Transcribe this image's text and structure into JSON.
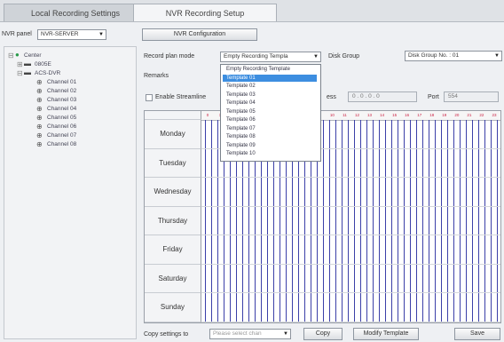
{
  "tabs": [
    {
      "label": "Local Recording Settings"
    },
    {
      "label": "NVR Recording Setup"
    }
  ],
  "topbar": {
    "nvr_label": "NVR panel",
    "nvr_value": "NVR-SERVER",
    "config_button": "NVR Configuration"
  },
  "tree": {
    "root": "Center",
    "nodes": [
      {
        "label": "0805E"
      },
      {
        "label": "ACS-DVR"
      }
    ],
    "channels": [
      "Channel 01",
      "Channel 02",
      "Channel 03",
      "Channel 04",
      "Channel 05",
      "Channel 06",
      "Channel 07",
      "Channel 08"
    ]
  },
  "form": {
    "mode_label": "Record plan mode",
    "mode_value": "Empty Recording Templa",
    "disk_group_label": "Disk Group",
    "disk_group_value": "Disk Group No. : 01",
    "remarks_label": "Remarks",
    "enable_label": "Enable Streamline",
    "ip_label": "ess",
    "ip_value": "0 . 0 . 0 . 0",
    "port_label": "Port",
    "port_value": "554"
  },
  "template_options": [
    "Empty Recording Template",
    "Template 01",
    "Template 02",
    "Template 03",
    "Template 04",
    "Template 05",
    "Template 06",
    "Template 07",
    "Template 08",
    "Template 09",
    "Template 10"
  ],
  "selected_option_index": 1,
  "schedule": {
    "days": [
      "Monday",
      "Tuesday",
      "Wednesday",
      "Thursday",
      "Friday",
      "Saturday",
      "Sunday"
    ],
    "hours": [
      "0",
      "1",
      "2",
      "3",
      "4",
      "5",
      "6",
      "7",
      "8",
      "9",
      "10",
      "11",
      "12",
      "13",
      "14",
      "15",
      "16",
      "17",
      "18",
      "19",
      "20",
      "21",
      "22",
      "23"
    ]
  },
  "footer": {
    "copy_label": "Copy settings to",
    "copy_placeholder": "Please select chan",
    "copy_button": "Copy",
    "modify_button": "Modify Template",
    "save_button": "Save"
  },
  "colors": {
    "accent": "#3d8ee0",
    "grid_line": "#3b3fa8"
  }
}
